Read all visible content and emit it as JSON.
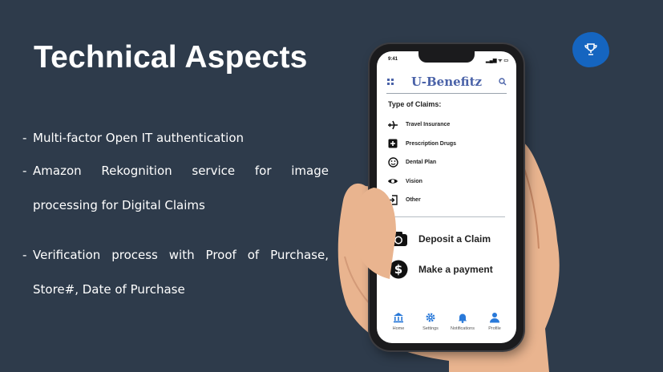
{
  "slide": {
    "title": "Technical Aspects",
    "bullets": [
      {
        "marker": "-",
        "text": "Multi-factor Open IT authentication"
      },
      {
        "marker": "-",
        "text": "Amazon Rekognition service for image processing for  Digital Claims"
      },
      {
        "marker": "-",
        "text": "Verification process with Proof of Purchase, Store#, Date of Purchase"
      }
    ],
    "badge_icon": "trophy-icon",
    "colors": {
      "background": "#2e3b4b",
      "badge": "#1565c0",
      "brand": "#4a62a8",
      "tab_icon": "#2979d9"
    }
  },
  "phone": {
    "status": {
      "time": "9:41",
      "indicators": "▂▄▆ ᯤ ▭"
    },
    "app_title": "U-Benefitz",
    "menu_icon": "grid-icon",
    "search_icon": "search-icon",
    "claims_heading": "Type of Claims:",
    "claim_types": [
      {
        "label": "Travel Insurance",
        "icon": "airplane-icon"
      },
      {
        "label": "Prescription Drugs",
        "icon": "plus-square-icon"
      },
      {
        "label": "Dental Plan",
        "icon": "smile-icon"
      },
      {
        "label": "Vision",
        "icon": "eye-icon"
      },
      {
        "label": "Other",
        "icon": "sign-in-icon"
      }
    ],
    "actions": [
      {
        "label": "Deposit a Claim",
        "icon": "camera-icon"
      },
      {
        "label": "Make a payment",
        "icon": "dollar-circle-icon"
      }
    ],
    "tabs": [
      {
        "label": "Home",
        "icon": "bank-icon"
      },
      {
        "label": "Settings",
        "icon": "gear-icon"
      },
      {
        "label": "Notifications",
        "icon": "bell-icon"
      },
      {
        "label": "Profile",
        "icon": "person-icon"
      }
    ]
  }
}
